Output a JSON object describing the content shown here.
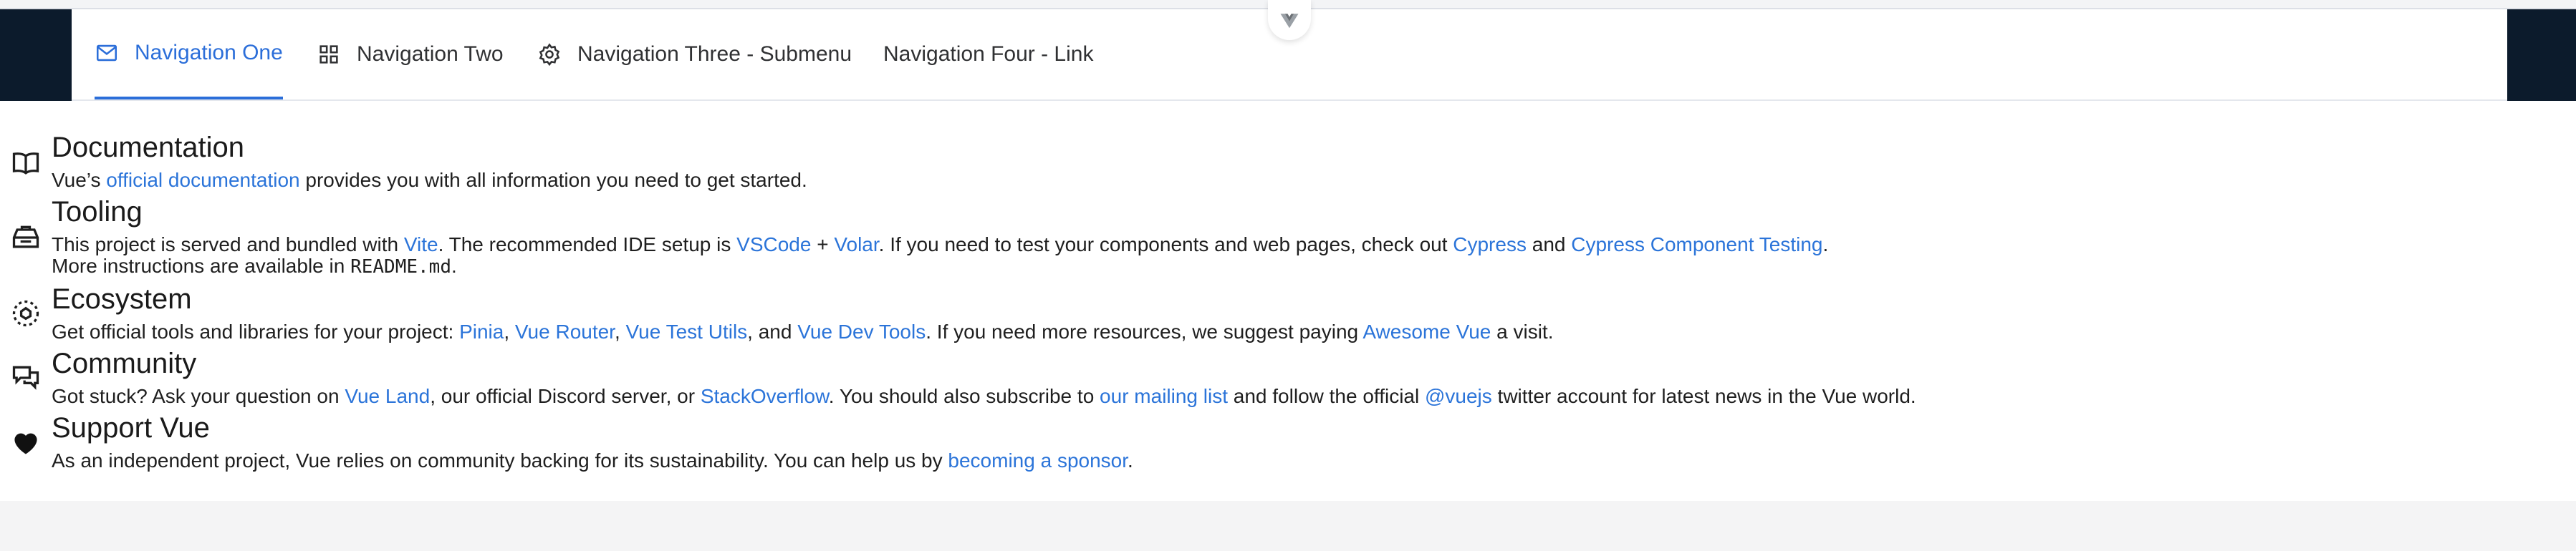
{
  "menu": {
    "items": [
      {
        "label": "Navigation One",
        "icon": "mail-icon",
        "active": true
      },
      {
        "label": "Navigation Two",
        "icon": "grid-icon",
        "active": false
      },
      {
        "label": "Navigation Three - Submenu",
        "icon": "gear-icon",
        "active": false
      },
      {
        "label": "Navigation Four - Link",
        "icon": "",
        "active": false
      }
    ],
    "active_color": "#2b6ed9"
  },
  "sections": {
    "documentation": {
      "title": "Documentation",
      "icon": "book-icon",
      "t1": "Vue’s ",
      "l1": "official documentation",
      "t2": " provides you with all information you need to get started."
    },
    "tooling": {
      "title": "Tooling",
      "icon": "toolbox-icon",
      "t1": "This project is served and bundled with ",
      "l1": "Vite",
      "t2": ". The recommended IDE setup is ",
      "l2": "VSCode",
      "t3": " + ",
      "l3": "Volar",
      "t4": ". If you need to test your components and web pages, check out ",
      "l4": "Cypress",
      "t5": " and ",
      "l5": "Cypress Component Testing",
      "t6": ".",
      "line2_text": "More instructions are available in ",
      "line2_code": "README.md",
      "line2_end": "."
    },
    "ecosystem": {
      "title": "Ecosystem",
      "icon": "ecosystem-icon",
      "t1": "Get official tools and libraries for your project: ",
      "l1": "Pinia",
      "t2": ", ",
      "l2": "Vue Router",
      "t3": ", ",
      "l3": "Vue Test Utils",
      "t4": ", and ",
      "l4": "Vue Dev Tools",
      "t5": ". If you need more resources, we suggest paying ",
      "l5": "Awesome Vue",
      "t6": " a visit."
    },
    "community": {
      "title": "Community",
      "icon": "chat-icon",
      "t1": "Got stuck? Ask your question on ",
      "l1": "Vue Land",
      "t2": ", our official Discord server, or ",
      "l2": "StackOverflow",
      "t3": ". You should also subscribe to ",
      "l3": "our mailing list",
      "t4": " and follow the official ",
      "l4": "@vuejs",
      "t5": " twitter account for latest news in the Vue world."
    },
    "support": {
      "title": "Support Vue",
      "icon": "heart-icon",
      "t1": "As an independent project, Vue relies on community backing for its sustainability. You can help us by ",
      "l1": "becoming a sponsor",
      "t2": "."
    }
  },
  "link_color": "#2b74d9"
}
